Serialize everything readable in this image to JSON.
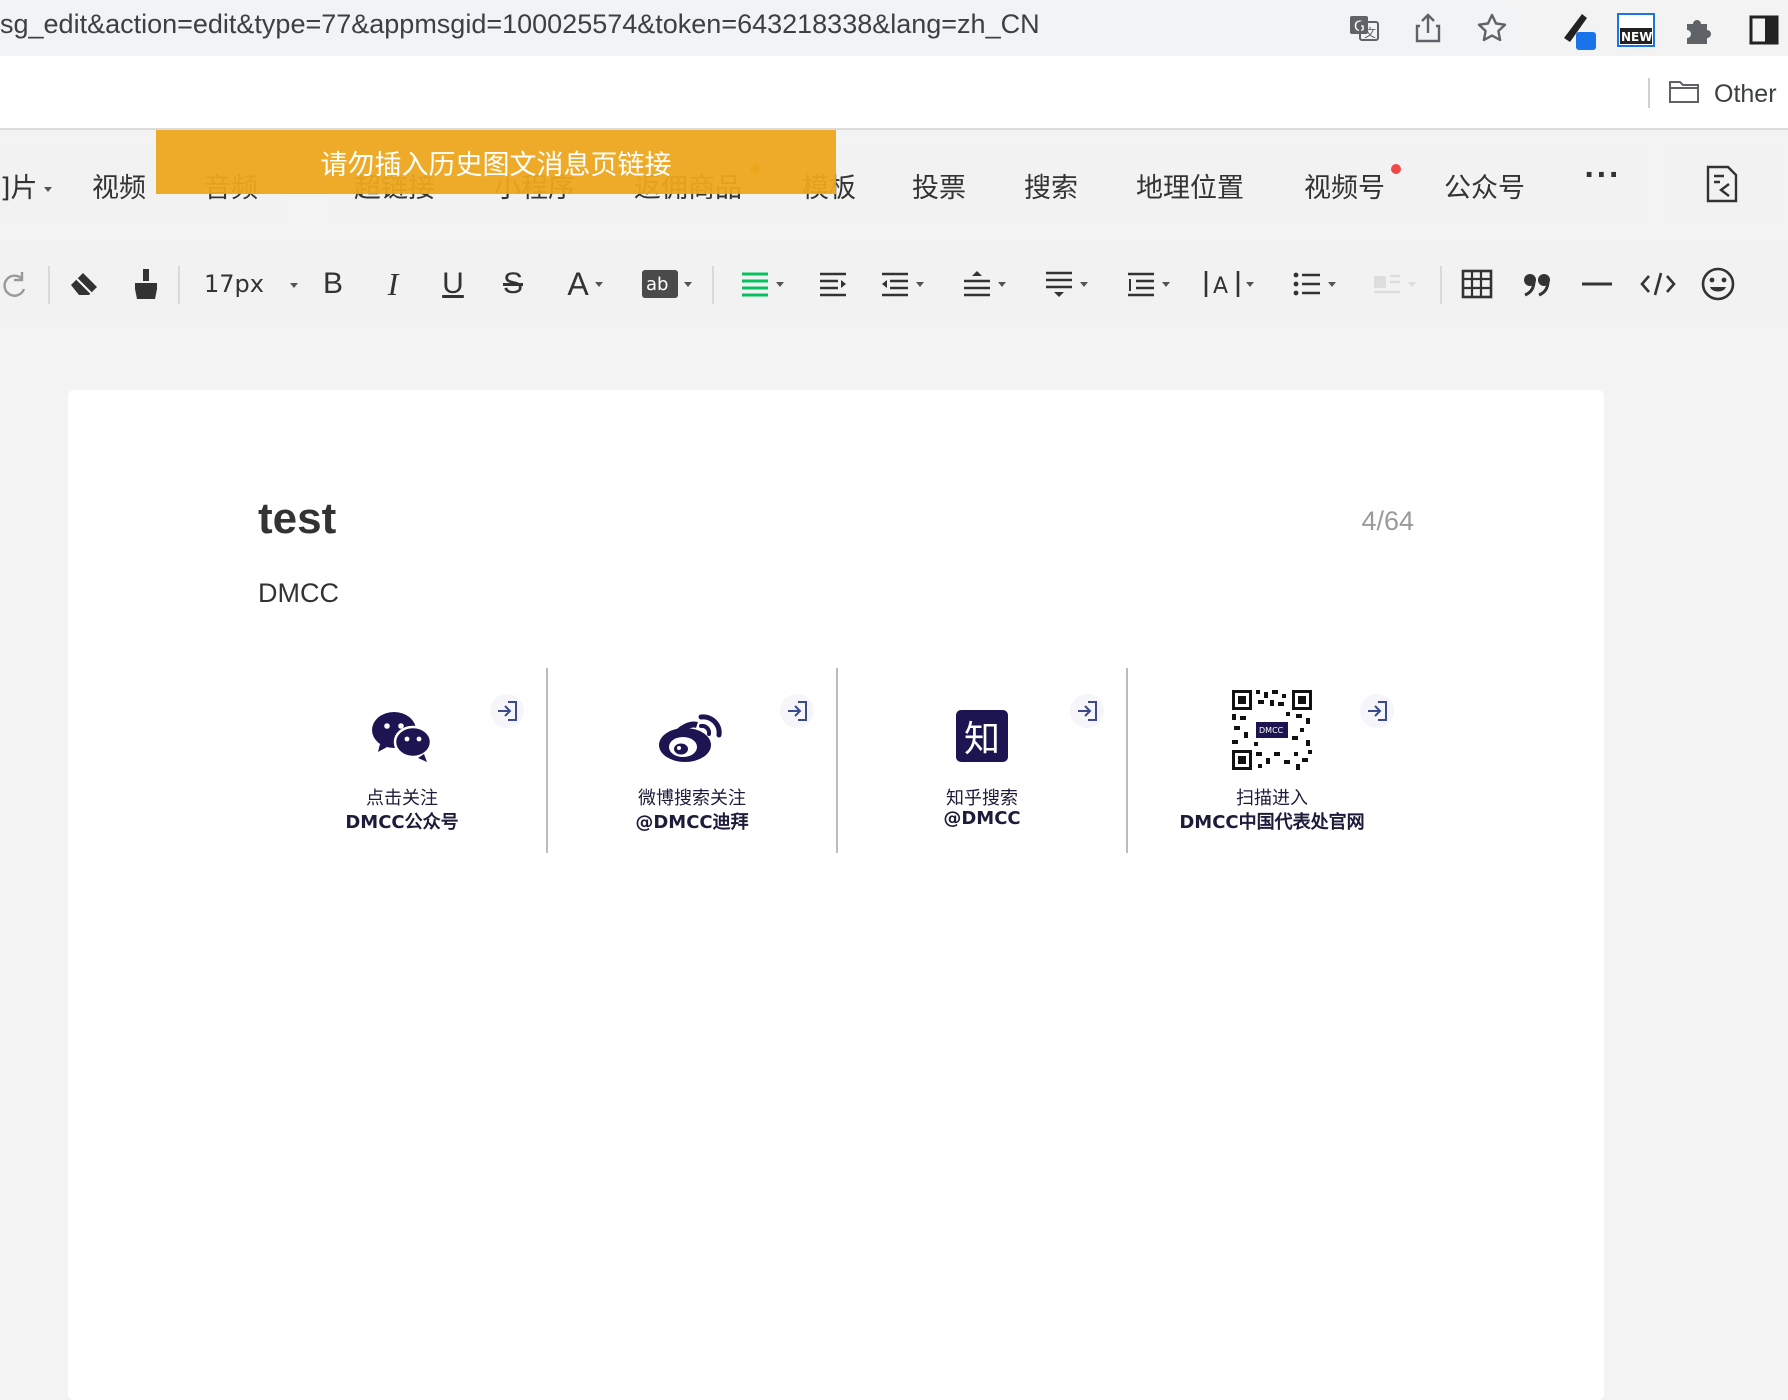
{
  "browser": {
    "url": "sg_edit&action=edit&type=77&appmsgid=100025574&token=643218338&lang=zh_CN",
    "bookmarks_other": "Other",
    "extension_badge": "NEW"
  },
  "editor": {
    "tabs": [
      "图片",
      "视频",
      "音频",
      "超链接",
      "小程序",
      "返佣商品",
      "模板",
      "投票",
      "搜索",
      "地理位置",
      "视频号",
      "公众号",
      "···"
    ],
    "tab_first_partial": "]片",
    "banner": "请勿插入历史图文消息页链接",
    "font_size": "17px"
  },
  "document": {
    "title": "test",
    "title_count": "4/64",
    "author": "DMCC",
    "social": [
      {
        "line1": "点击关注",
        "line2": "DMCC公众号",
        "icon": "wechat-icon"
      },
      {
        "line1": "微博搜索关注",
        "line2": "@DMCC迪拜",
        "icon": "weibo-icon"
      },
      {
        "line1": "知乎搜索",
        "line2": "@DMCC",
        "icon": "zhihu-icon",
        "icon_text": "知"
      },
      {
        "line1": "扫描进入",
        "line2": "DMCC中国代表处官网",
        "icon": "qr-code-icon",
        "qr_label": "DMCC"
      }
    ]
  },
  "colors": {
    "banner": "#eca61e",
    "brand_navy": "#1c1551",
    "accent_green": "#07c160",
    "dot_red": "#f04848",
    "dot_orange": "#f5a623"
  }
}
